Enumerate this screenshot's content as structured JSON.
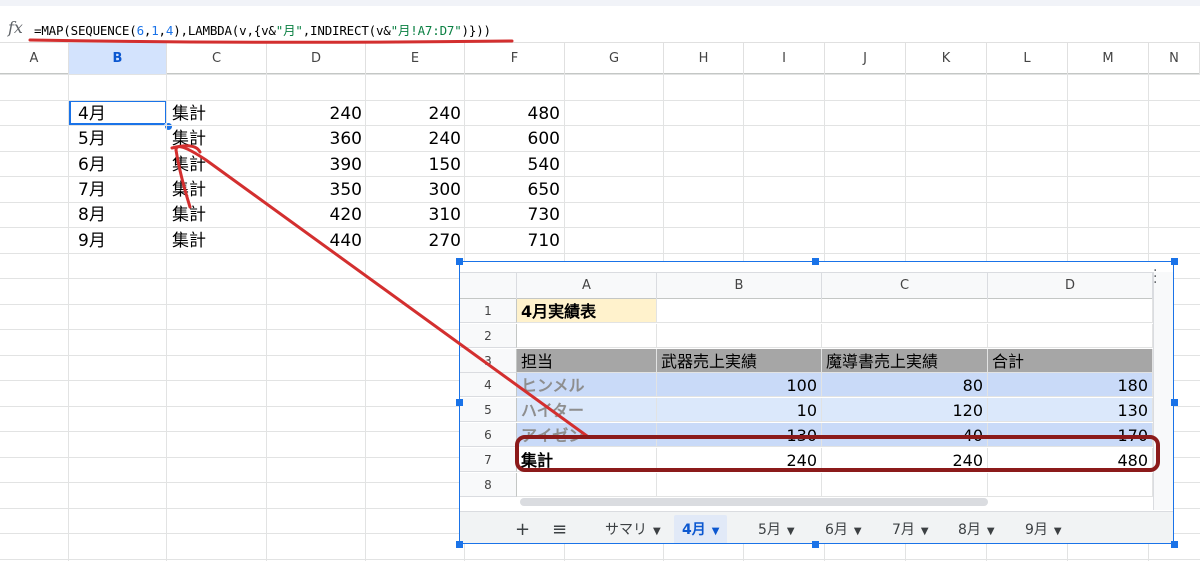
{
  "formula_bar": {
    "fx_label": "fx",
    "parts": [
      {
        "t": "=MAP(SEQUENCE(",
        "k": "plain"
      },
      {
        "t": "6",
        "k": "num"
      },
      {
        "t": ",",
        "k": "plain"
      },
      {
        "t": "1",
        "k": "num"
      },
      {
        "t": ",",
        "k": "plain"
      },
      {
        "t": "4",
        "k": "num"
      },
      {
        "t": "),LAMBDA(v,{v&",
        "k": "plain"
      },
      {
        "t": "\"月\"",
        "k": "str"
      },
      {
        "t": ",INDIRECT(v&",
        "k": "plain"
      },
      {
        "t": "\"月!A7:D7\"",
        "k": "str"
      },
      {
        "t": ")}))",
        "k": "plain"
      }
    ]
  },
  "columns": [
    "A",
    "B",
    "C",
    "D",
    "E",
    "F",
    "G",
    "H",
    "I",
    "J",
    "K",
    "L",
    "M",
    "N"
  ],
  "selected_column": "B",
  "rows": [
    {
      "b": "4月",
      "c": "集計",
      "d": "240",
      "e": "240",
      "f": "480"
    },
    {
      "b": "5月",
      "c": "集計",
      "d": "360",
      "e": "240",
      "f": "600"
    },
    {
      "b": "6月",
      "c": "集計",
      "d": "390",
      "e": "150",
      "f": "540"
    },
    {
      "b": "7月",
      "c": "集計",
      "d": "350",
      "e": "300",
      "f": "650"
    },
    {
      "b": "8月",
      "c": "集計",
      "d": "420",
      "e": "310",
      "f": "730"
    },
    {
      "b": "9月",
      "c": "集計",
      "d": "440",
      "e": "270",
      "f": "710"
    }
  ],
  "embedded": {
    "columns": [
      "A",
      "B",
      "C",
      "D"
    ],
    "row_numbers": [
      "1",
      "2",
      "3",
      "4",
      "5",
      "6",
      "7",
      "8"
    ],
    "title": "4月実績表",
    "header": [
      "担当",
      "武器売上実績",
      "魔導書売上実績",
      "合計"
    ],
    "data": [
      [
        "ヒンメル",
        "100",
        "80",
        "180"
      ],
      [
        "ハイター",
        "10",
        "120",
        "130"
      ],
      [
        "アイゼン",
        "130",
        "40",
        "170"
      ]
    ],
    "total": [
      "集計",
      "240",
      "240",
      "480"
    ],
    "tabs": {
      "add": "+",
      "menu": "≡",
      "sheets": [
        "サマリ",
        "4月",
        "5月",
        "6月",
        "7月",
        "8月",
        "9月"
      ],
      "active": "4月"
    }
  },
  "colors": {
    "accent": "#1a73e8",
    "annotation_red": "#d32f2f",
    "annotation_dark_red": "#8b1a1a",
    "title_fill": "#fff2cc",
    "header_fill": "#a6a6a6",
    "row_blue_dark": "#c9daf8",
    "row_blue_light": "#dbe8fb"
  }
}
